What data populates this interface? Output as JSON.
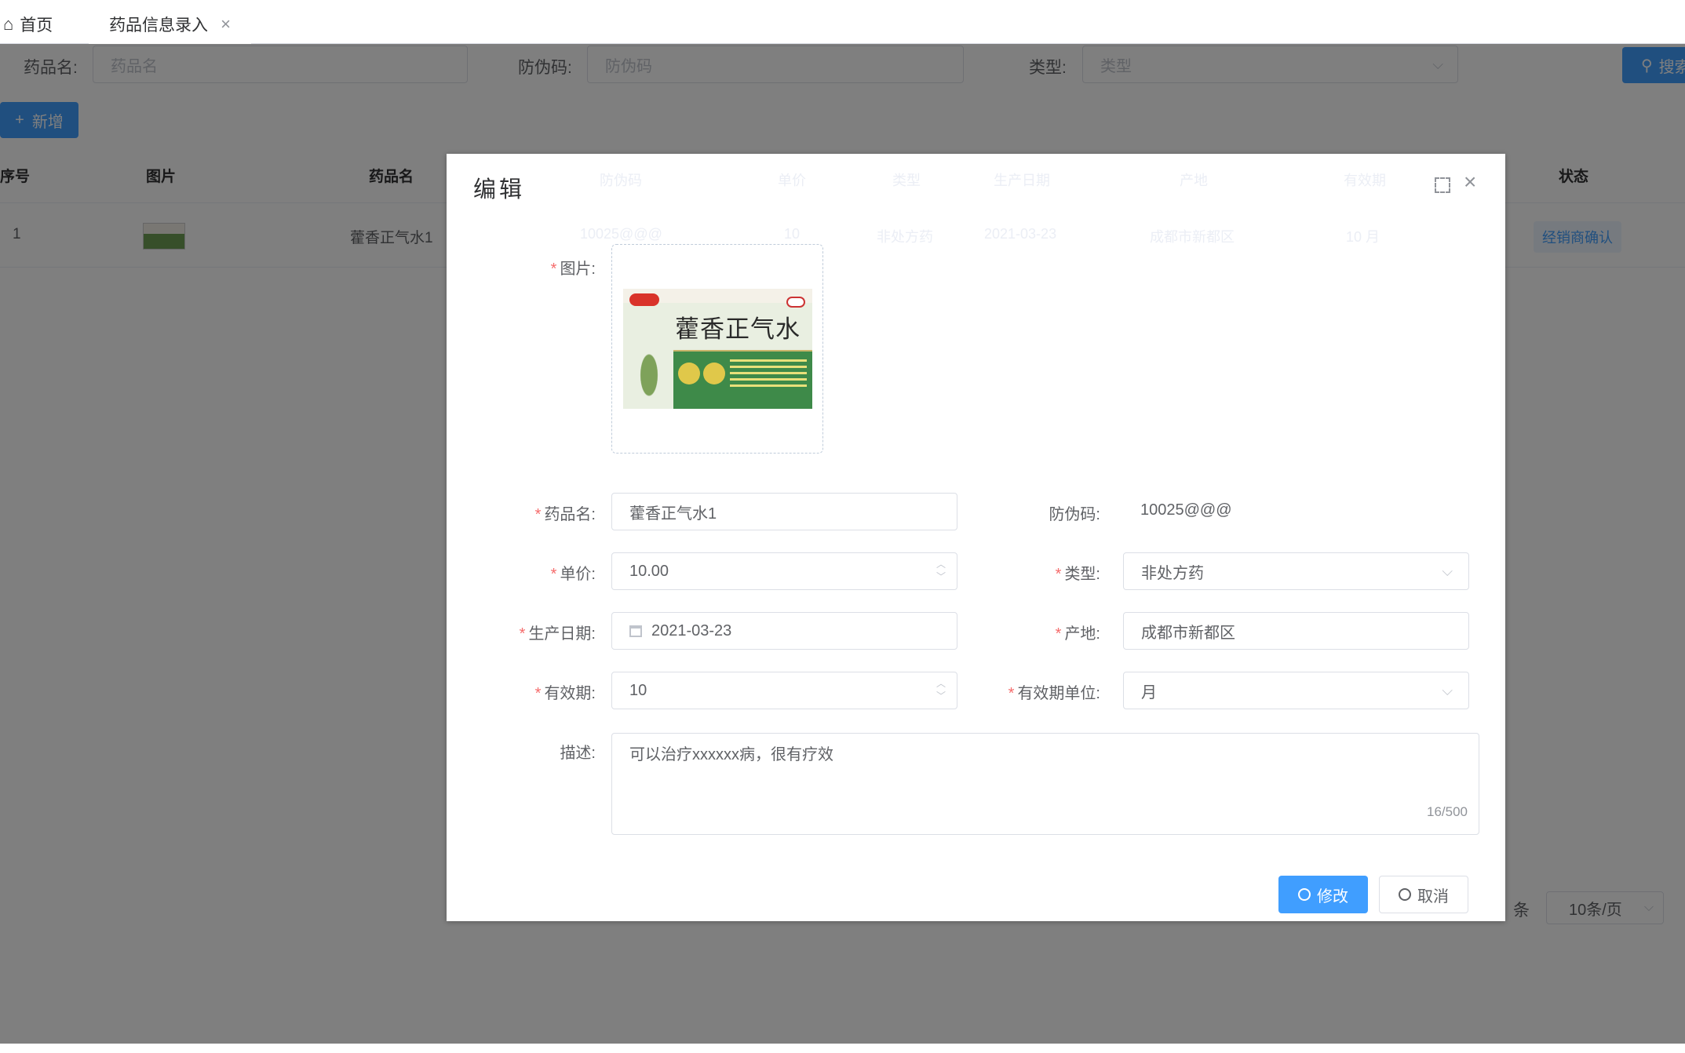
{
  "tabs": {
    "home_label": "首页",
    "active_label": "药品信息录入",
    "close_glyph": "×"
  },
  "filters": {
    "name_label": "药品名:",
    "name_placeholder": "药品名",
    "code_label": "防伪码:",
    "code_placeholder": "防伪码",
    "type_label": "类型:",
    "type_placeholder": "类型",
    "search_label": "搜索"
  },
  "toolbar": {
    "add_label": "新增"
  },
  "table": {
    "headers": [
      "序号",
      "图片",
      "药品名",
      "防伪码",
      "单价",
      "类型",
      "生产日期",
      "产地",
      "有效期",
      "状态"
    ],
    "row": {
      "index": "1",
      "name": "藿香正气水1",
      "code": "10025@@@",
      "price": "10",
      "type": "非处方药",
      "date": "2021-03-23",
      "origin": "成都市新都区",
      "validity": "10 月",
      "status": "经销商确认"
    }
  },
  "pager": {
    "suffix": "条",
    "page_size": "10条/页"
  },
  "dialog": {
    "title": "编辑",
    "image_label": "图片:",
    "image_product_name": "藿香正气水",
    "name_label": "药品名:",
    "name_value": "藿香正气水1",
    "code_label": "防伪码:",
    "code_value": "10025@@@",
    "price_label": "单价:",
    "price_value": "10.00",
    "type_label": "类型:",
    "type_value": "非处方药",
    "date_label": "生产日期:",
    "date_value": "2021-03-23",
    "origin_label": "产地:",
    "origin_value": "成都市新都区",
    "validity_label": "有效期:",
    "validity_value": "10",
    "unit_label": "有效期单位:",
    "unit_value": "月",
    "desc_label": "描述:",
    "desc_value": "可以治疗xxxxxx病，很有疗效",
    "desc_count": "16/500",
    "submit_label": "修改",
    "cancel_label": "取消"
  },
  "colors": {
    "primary": "#409eff",
    "required": "#f56c6c",
    "overlay": "rgba(0,0,0,0.5)"
  }
}
